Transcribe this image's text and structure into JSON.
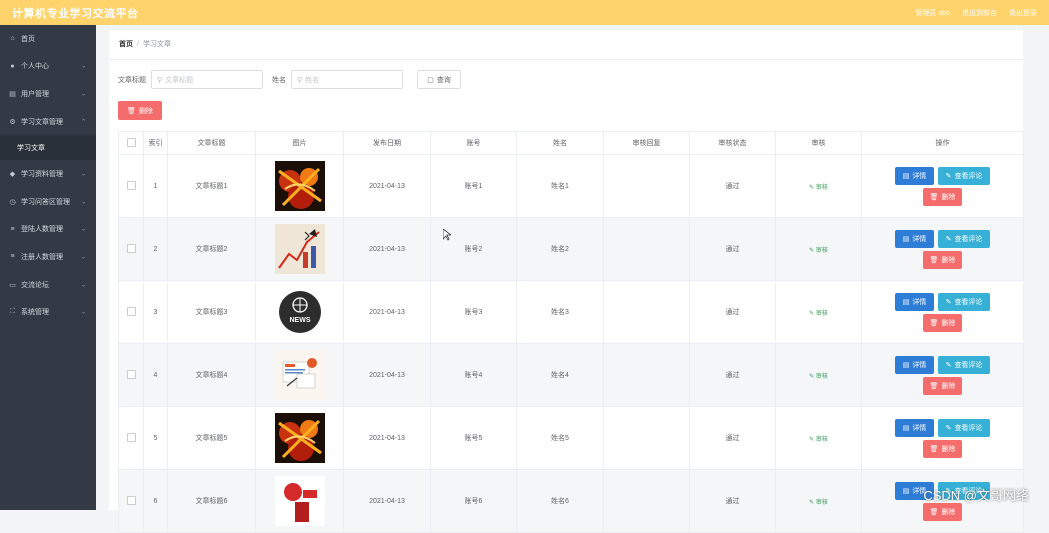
{
  "header": {
    "title": "计算机专业学习交流平台",
    "links": [
      "管理员 abo",
      "退出到前台",
      "退出登录"
    ]
  },
  "sidebar": {
    "items": [
      {
        "label": "首页",
        "icon": "home-icon"
      },
      {
        "label": "个人中心",
        "icon": "user-icon"
      },
      {
        "label": "用户管理",
        "icon": "users-icon"
      },
      {
        "label": "学习文章管理",
        "icon": "gear-icon",
        "expanded": true
      },
      {
        "label": "学习资料管理",
        "icon": "drop-icon"
      },
      {
        "label": "学习问答区管理",
        "icon": "clock-icon"
      },
      {
        "label": "登陆人数管理",
        "icon": "list-icon"
      },
      {
        "label": "注册人数管理",
        "icon": "list-icon"
      },
      {
        "label": "交流论坛",
        "icon": "chat-icon"
      },
      {
        "label": "系统管理",
        "icon": "expand-icon"
      }
    ],
    "sub_item": "学习文章"
  },
  "breadcrumb": {
    "home": "首页",
    "current": "学习文章"
  },
  "search": {
    "title_label": "文章标题",
    "title_placeholder": "文章标题",
    "name_label": "姓名",
    "name_placeholder": "姓名",
    "query_label": "查询"
  },
  "toolbar": {
    "delete_label": "删除"
  },
  "table": {
    "headers": [
      "索引",
      "文章标题",
      "图片",
      "发布日期",
      "账号",
      "姓名",
      "审核回复",
      "审核状态",
      "审核",
      "操作"
    ],
    "rows": [
      {
        "index": "1",
        "title": "文章标题1",
        "date": "2021-04-13",
        "account": "账号1",
        "name": "姓名1",
        "reply": "",
        "status": "通过",
        "review": "审核",
        "image": "fire-art"
      },
      {
        "index": "2",
        "title": "文章标题2",
        "date": "2021-04-13",
        "account": "账号2",
        "name": "姓名2",
        "reply": "",
        "status": "通过",
        "review": "审核",
        "image": "chart-art"
      },
      {
        "index": "3",
        "title": "文章标题3",
        "date": "2021-04-13",
        "account": "账号3",
        "name": "姓名3",
        "reply": "",
        "status": "通过",
        "review": "审核",
        "image": "news-art"
      },
      {
        "index": "4",
        "title": "文章标题4",
        "date": "2021-04-13",
        "account": "账号4",
        "name": "姓名4",
        "reply": "",
        "status": "通过",
        "review": "审核",
        "image": "doc-art"
      },
      {
        "index": "5",
        "title": "文章标题5",
        "date": "2021-04-13",
        "account": "账号5",
        "name": "姓名5",
        "reply": "",
        "status": "通过",
        "review": "审核",
        "image": "fire-art"
      },
      {
        "index": "6",
        "title": "文章标题6",
        "date": "2021-04-13",
        "account": "账号6",
        "name": "姓名6",
        "reply": "",
        "status": "通过",
        "review": "审核",
        "image": "mic-art"
      }
    ],
    "actions": {
      "detail": "详情",
      "comment": "查看评论",
      "delete": "删除"
    }
  },
  "watermark": "CSDN @文哥网络",
  "colors": {
    "header": "#ffd36b",
    "sidebar": "#333a45",
    "danger": "#f56c6c",
    "primary": "#2d7cd6",
    "info": "#36b0d6"
  }
}
